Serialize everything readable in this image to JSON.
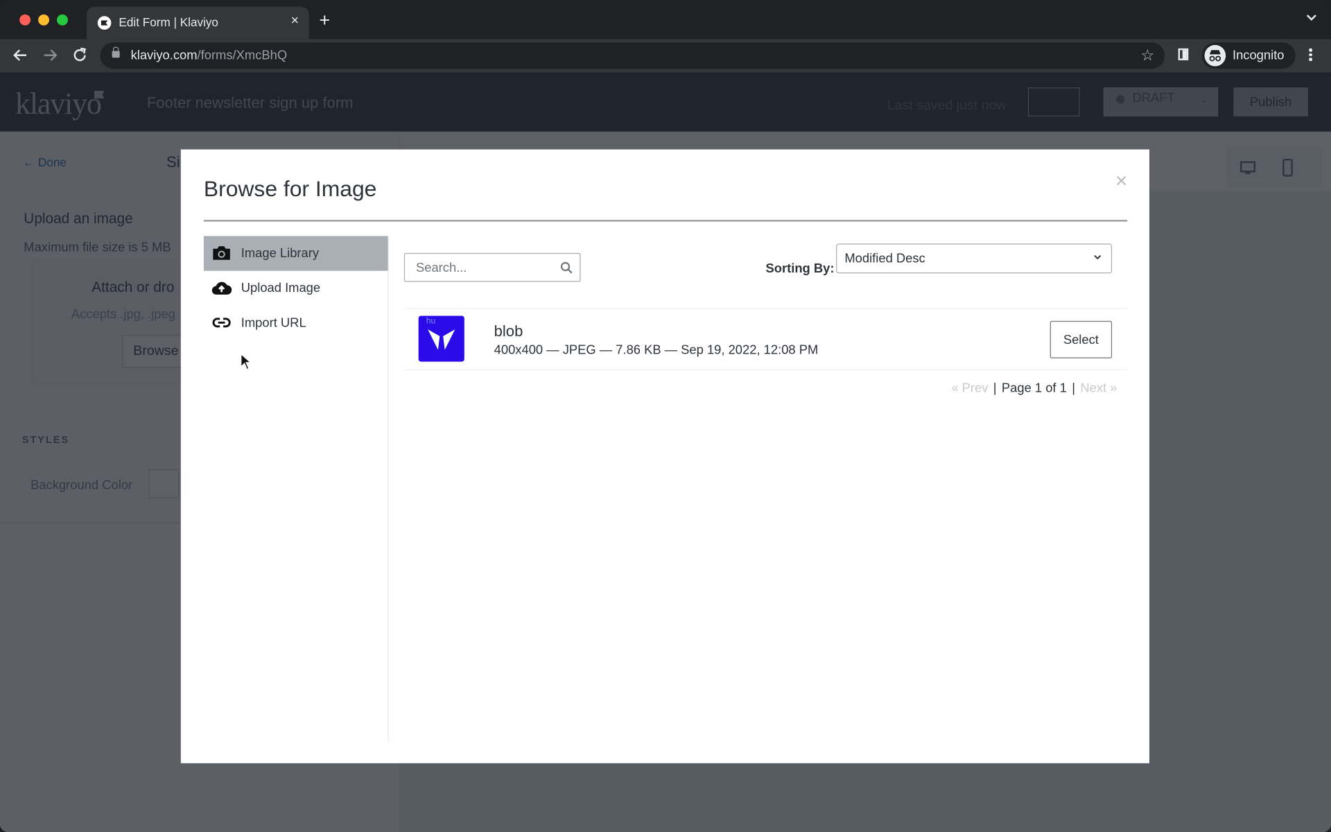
{
  "browser": {
    "tab_title": "Edit Form | Klaviyo",
    "tab_close": "×",
    "new_tab": "+",
    "url_domain": "klaviyo.com",
    "url_path": "/forms/XmcBhQ",
    "star": "☆",
    "profile_label": "Incognito"
  },
  "app": {
    "logo": "klaviyo",
    "form_title": "Footer newsletter sign up form",
    "last_saved": "Last saved just now",
    "exit_label": "Exit",
    "status_label": "DRAFT",
    "status_caret": "⌄",
    "publish_label": "Publish",
    "left_panel": {
      "done_label": "← Done",
      "heading_fragment": "Si",
      "upload_title": "Upload an image",
      "upload_sub": "Maximum file size is 5 MB",
      "dropzone_title": "Attach or dro",
      "dropzone_sub": "Accepts .jpg, .jpeg",
      "browse_label": "Browse",
      "styles_label": "STYLES",
      "bg_color_label": "Background Color"
    }
  },
  "modal": {
    "title": "Browse for Image",
    "close": "×",
    "nav": [
      {
        "label": "Image Library",
        "icon": "camera-icon",
        "active": true
      },
      {
        "label": "Upload Image",
        "icon": "cloud-upload-icon",
        "active": false
      },
      {
        "label": "Import URL",
        "icon": "link-icon",
        "active": false
      }
    ],
    "search_placeholder": "Search...",
    "sort_label": "Sorting By:",
    "sort_value": "Modified Desc",
    "images": [
      {
        "name": "blob",
        "meta": "400x400 — JPEG — 7.86 KB — Sep 19, 2022, 12:08 PM",
        "thumb_color": "#2b0ce8",
        "thumb_text": "hu",
        "select_label": "Select"
      }
    ],
    "pager": {
      "prev": "« Prev",
      "separator": "|",
      "page": "Page 1 of 1",
      "next": "Next »"
    }
  }
}
